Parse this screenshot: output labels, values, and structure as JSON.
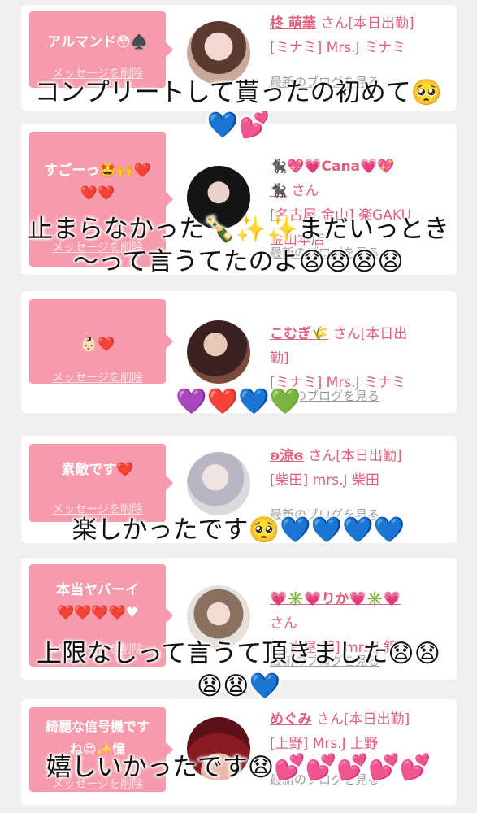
{
  "delete_label": "メッセージを削除",
  "blog_label": "最新のブログを見る",
  "cards": [
    {
      "message": "アルマンド😳♠️",
      "name": "柊 萌華",
      "san": " さん[本日出勤]",
      "shop": "[ミナミ] Mrs.J ミナミ"
    },
    {
      "message": "すごーっ🤩🙌❤️\n❤️❤️",
      "name": "🐈‍⬛💖💗Cana💗💖\n🐈‍⬛",
      "san": " さん",
      "shop": "[名古屋 金山] 楽GAKU\n金山本店"
    },
    {
      "message": "👶🏻❤️",
      "name": "こむぎ🌾",
      "san": " さん[本日出\n勤]",
      "shop": "[ミナミ] Mrs.J ミナミ"
    },
    {
      "message": "素敵です❤️",
      "name": "ʚ涼ɞ",
      "san": " さん[本日出勤]",
      "shop": "[柴田] mrs.J 柴田"
    },
    {
      "message": "本当ヤバーイ\n❤️❤️❤️❤️♥",
      "name": "💗✳️💗りか💗✳️💗",
      "san": "\nさん",
      "shop": "[名古屋 錦] mrs.J 錦"
    },
    {
      "message": "綺麗な信号機です\nね😍✨憧",
      "name": "めぐみ",
      "san": " さん[本日出勤]",
      "shop": "[上野] Mrs.J 上野"
    }
  ],
  "overlays": [
    "コンプリートして貰ったの初めて🥺\n💙💕",
    "止まらなかった🍾✨✨まだいっとき\n〜って言うてたのよ😧😧😧😧",
    "💜❤️💙💚",
    "楽しかったです🥺💙💙💙💙",
    "上限なしって言うて頂きました😧😧\n😧😧💙",
    "嬉しいかったです😧💕💕💕💕💕"
  ]
}
